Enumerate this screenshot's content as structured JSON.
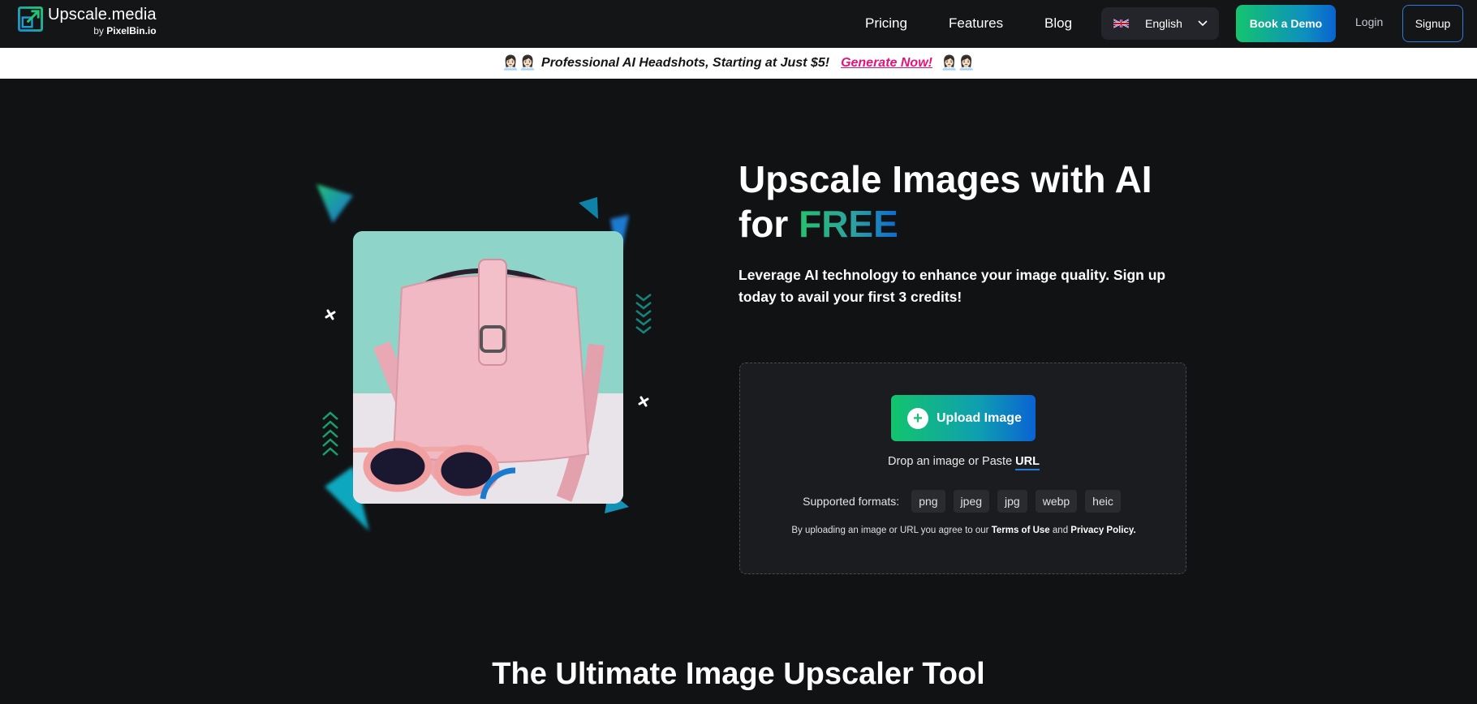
{
  "nav": {
    "logo_main": "Upscale.media",
    "logo_by": "by",
    "logo_brand": "PixelBin.io",
    "links": [
      "Pricing",
      "Features",
      "Blog"
    ],
    "language": "English",
    "book_demo": "Book a Demo",
    "login": "Login",
    "signup": "Signup"
  },
  "promo": {
    "emoji": "👩🏻‍💼👩🏻‍💼",
    "text": "Professional AI Headshots, Starting at Just $5!",
    "link": "Generate Now!"
  },
  "hero": {
    "title_line1": "Upscale Images with AI",
    "title_for": "for",
    "title_free": "FREE",
    "subtitle": "Leverage AI technology to enhance your image quality. Sign up today to avail your first 3 credits!"
  },
  "upload": {
    "button": "Upload Image",
    "drop_text": "Drop an image or Paste",
    "url": "URL",
    "formats_label": "Supported formats:",
    "formats": [
      "png",
      "jpeg",
      "jpg",
      "webp",
      "heic"
    ],
    "terms_prefix": "By uploading an image or URL you agree to our",
    "terms_link": "Terms of Use",
    "terms_and": "and",
    "privacy_link": "Privacy Policy."
  },
  "section_title": "The Ultimate Image Upscaler Tool",
  "colors": {
    "background": "#111214",
    "accent_green": "#14c46f",
    "accent_blue": "#0a62d0",
    "promo_link": "#e3137a"
  }
}
